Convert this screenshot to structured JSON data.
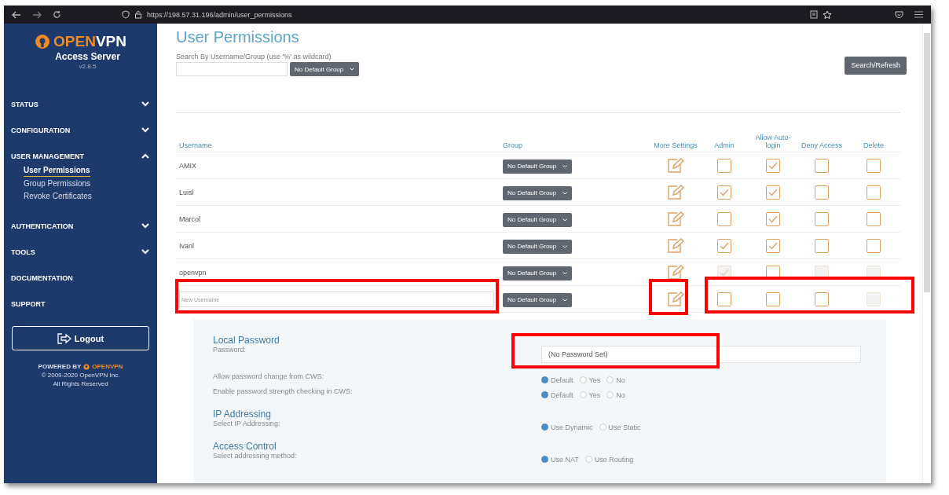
{
  "browser": {
    "url": "https://198.57.31.196/admin/user_permissions"
  },
  "sidebar": {
    "logo": {
      "brand_a": "OPEN",
      "brand_b": "VPN",
      "product": "Access Server",
      "version": "v2.8.5"
    },
    "items": [
      {
        "label": "STATUS",
        "expanded": false
      },
      {
        "label": "CONFIGURATION",
        "expanded": false
      },
      {
        "label": "USER MANAGEMENT",
        "expanded": true,
        "children": [
          {
            "label": "User Permissions",
            "selected": true
          },
          {
            "label": "Group Permissions",
            "selected": false
          },
          {
            "label": "Revoke Certificates",
            "selected": false
          }
        ]
      },
      {
        "label": "AUTHENTICATION",
        "expanded": false
      },
      {
        "label": "TOOLS",
        "expanded": false
      },
      {
        "label": "DOCUMENTATION"
      },
      {
        "label": "SUPPORT"
      }
    ],
    "logout": "Logout",
    "footer": {
      "powered_by": "POWERED BY",
      "brand": "OPENVPN",
      "copyright": "© 2009-2020 OpenVPN Inc.",
      "rights": "All Rights Reserved"
    }
  },
  "page": {
    "title": "User Permissions",
    "search_label": "Search By Username/Group (use '%' as wildcard)",
    "group_filter": "No Default Group",
    "search_button": "Search/Refresh"
  },
  "table": {
    "columns": [
      "Username",
      "Group",
      "More Settings",
      "Admin",
      "Allow Auto-login",
      "Deny Access",
      "Delete"
    ],
    "rows": [
      {
        "username": "AMIX",
        "group": "No Default Group",
        "admin": {
          "checked": false,
          "disabled": false
        },
        "auto_login": {
          "checked": true,
          "disabled": false
        },
        "deny_access": {
          "checked": false,
          "disabled": false
        },
        "delete": {
          "checked": false,
          "disabled": false
        }
      },
      {
        "username": "Luisl",
        "group": "No Default Group",
        "admin": {
          "checked": true,
          "disabled": false
        },
        "auto_login": {
          "checked": true,
          "disabled": false
        },
        "deny_access": {
          "checked": false,
          "disabled": false
        },
        "delete": {
          "checked": false,
          "disabled": false
        }
      },
      {
        "username": "Marcol",
        "group": "No Default Group",
        "admin": {
          "checked": false,
          "disabled": false
        },
        "auto_login": {
          "checked": true,
          "disabled": false
        },
        "deny_access": {
          "checked": false,
          "disabled": false
        },
        "delete": {
          "checked": false,
          "disabled": false
        }
      },
      {
        "username": "Ivanl",
        "group": "No Default Group",
        "admin": {
          "checked": true,
          "disabled": false
        },
        "auto_login": {
          "checked": true,
          "disabled": false
        },
        "deny_access": {
          "checked": false,
          "disabled": false
        },
        "delete": {
          "checked": false,
          "disabled": false
        }
      },
      {
        "username": "openvpn",
        "group": "No Default Group",
        "admin": {
          "checked": true,
          "disabled": true
        },
        "auto_login": {
          "checked": false,
          "disabled": false
        },
        "deny_access": {
          "checked": false,
          "disabled": true
        },
        "delete": {
          "checked": false,
          "disabled": true
        }
      }
    ],
    "new_row": {
      "placeholder": "New Username",
      "group": "No Default Group",
      "admin": {
        "checked": false,
        "disabled": false
      },
      "auto_login": {
        "checked": false,
        "disabled": false
      },
      "deny_access": {
        "checked": false,
        "disabled": false
      },
      "delete": {
        "checked": false,
        "disabled": true
      }
    }
  },
  "settings": [
    {
      "heading": "Local Password",
      "fields": [
        {
          "label": "Password:",
          "kind": "text",
          "placeholder": "(No Password Set)"
        },
        {
          "label": "Allow password change from CWS:",
          "kind": "radio",
          "options": [
            {
              "label": "Default",
              "selected": true
            },
            {
              "label": "Yes",
              "selected": false
            },
            {
              "label": "No",
              "selected": false
            }
          ]
        },
        {
          "label": "Enable password strength checking in CWS:",
          "kind": "radio",
          "options": [
            {
              "label": "Default",
              "selected": true
            },
            {
              "label": "Yes",
              "selected": false
            },
            {
              "label": "No",
              "selected": false
            }
          ]
        }
      ]
    },
    {
      "heading": "IP Addressing",
      "fields": [
        {
          "label": "Select IP Addressing:",
          "kind": "radio",
          "options": [
            {
              "label": "Use Dynamic",
              "selected": true
            },
            {
              "label": "Use Static",
              "selected": false
            }
          ]
        }
      ]
    },
    {
      "heading": "Access Control",
      "fields": [
        {
          "label": "Select addressing method:",
          "kind": "radio",
          "options": [
            {
              "label": "Use NAT",
              "selected": true
            },
            {
              "label": "Use Routing",
              "selected": false
            }
          ]
        }
      ]
    }
  ]
}
